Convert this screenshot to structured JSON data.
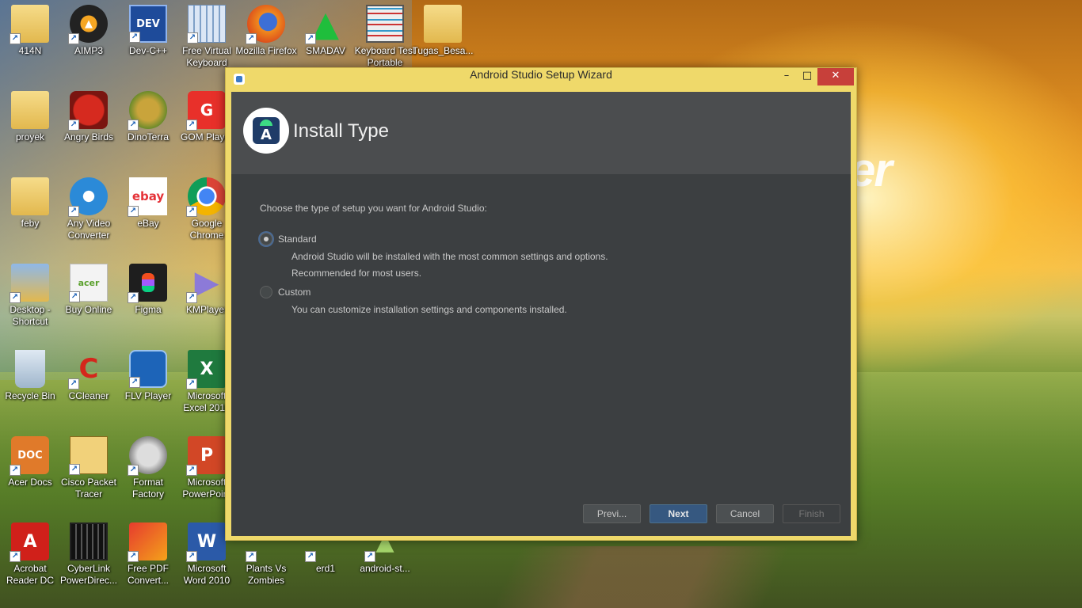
{
  "desktop": {
    "brand_text": "er",
    "icons": [
      {
        "label": "414N",
        "kind": "folder"
      },
      {
        "label": "AIMP3",
        "kind": "aimp"
      },
      {
        "label": "Dev-C++",
        "kind": "dev"
      },
      {
        "label": "Free Virtual Keyboard",
        "kind": "keyboard"
      },
      {
        "label": "Mozilla Firefox",
        "kind": "firefox"
      },
      {
        "label": "SMADAV",
        "kind": "smadav"
      },
      {
        "label": "Keyboard Test Portable",
        "kind": "kbtest"
      },
      {
        "label": "Tugas_Besa...",
        "kind": "folder"
      },
      {
        "label": "proyek",
        "kind": "folder"
      },
      {
        "label": "Angry Birds",
        "kind": "angrybirds"
      },
      {
        "label": "DinoTerra",
        "kind": "dino"
      },
      {
        "label": "GOM Player",
        "kind": "gom"
      },
      {
        "label": "feby",
        "kind": "folder"
      },
      {
        "label": "Any Video Converter",
        "kind": "avc"
      },
      {
        "label": "eBay",
        "kind": "ebay"
      },
      {
        "label": "Google Chrome",
        "kind": "chrome"
      },
      {
        "label": "Desktop - Shortcut",
        "kind": "folder"
      },
      {
        "label": "Buy Online",
        "kind": "acer"
      },
      {
        "label": "Figma",
        "kind": "figma"
      },
      {
        "label": "KMPlayer",
        "kind": "kmp"
      },
      {
        "label": "Recycle Bin",
        "kind": "bin"
      },
      {
        "label": "CCleaner",
        "kind": "ccleaner"
      },
      {
        "label": "FLV Player",
        "kind": "flv"
      },
      {
        "label": "Microsoft Excel 2010",
        "kind": "excel"
      },
      {
        "label": "Acer Docs",
        "kind": "acerdocs"
      },
      {
        "label": "Cisco Packet Tracer",
        "kind": "cisco"
      },
      {
        "label": "Format Factory",
        "kind": "format"
      },
      {
        "label": "Microsoft PowerPoint",
        "kind": "ppt"
      },
      {
        "label": "Acrobat Reader DC",
        "kind": "acrobat"
      },
      {
        "label": "CyberLink PowerDirec...",
        "kind": "cyberlink"
      },
      {
        "label": "Free PDF Convert...",
        "kind": "pdf"
      },
      {
        "label": "Microsoft Word 2010",
        "kind": "word"
      },
      {
        "label": "Plants Vs Zombies",
        "kind": "pvz"
      },
      {
        "label": "erd1",
        "kind": "chrome"
      },
      {
        "label": "android-st...",
        "kind": "android"
      }
    ]
  },
  "window": {
    "title": "Android Studio Setup Wizard",
    "controls": {
      "minimize": "–",
      "maximize": "□",
      "close": "✕"
    },
    "header_title": "Install Type",
    "prompt": "Choose the type of setup you want for Android Studio:",
    "options": [
      {
        "label": "Standard",
        "checked": true,
        "desc": [
          "Android Studio will be installed with the most common settings and options.",
          "Recommended for most users."
        ]
      },
      {
        "label": "Custom",
        "checked": false,
        "desc": [
          "You can customize installation settings and components installed."
        ]
      }
    ],
    "buttons": {
      "prev": "Previ...",
      "next": "Next",
      "cancel": "Cancel",
      "finish": "Finish"
    }
  },
  "colors": {
    "title_bar": "#efd96a",
    "dialog_bg": "#3c3f41",
    "header_bg": "#4b4d4f",
    "primary_button": "#365880",
    "close_button": "#c7403a"
  }
}
